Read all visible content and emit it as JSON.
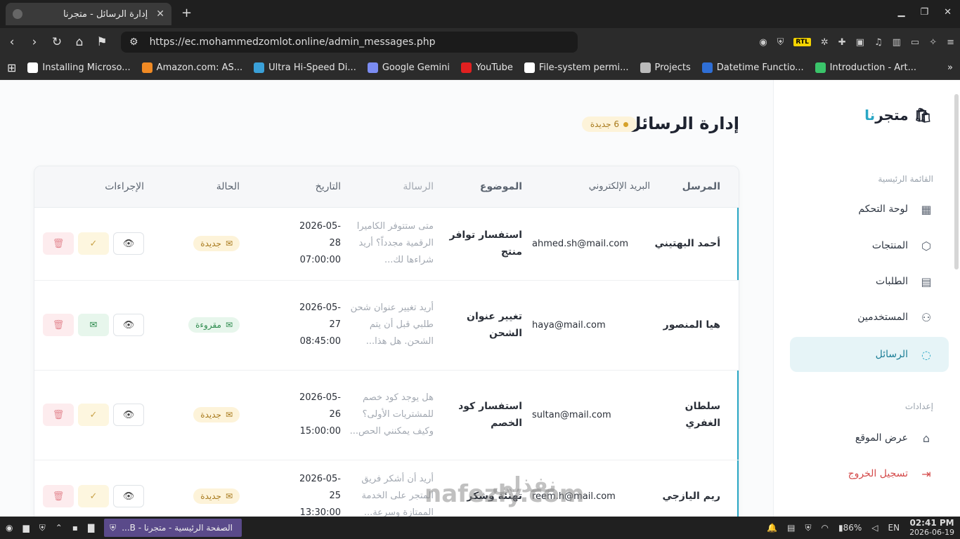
{
  "browser": {
    "tab_title": "إدارة الرسائل - متجرنا",
    "url": "https://ec.mohammedzomlot.online/admin_messages.php",
    "bookmarks": [
      {
        "label": "Installing Microso...",
        "color": "#ffffff"
      },
      {
        "label": "Amazon.com: AS...",
        "color": "#f08a24"
      },
      {
        "label": "Ultra Hi-Speed Di...",
        "color": "#3aa0d8"
      },
      {
        "label": "Google Gemini",
        "color": "#7b8cf2"
      },
      {
        "label": "YouTube",
        "color": "#e02020"
      },
      {
        "label": "File-system permi...",
        "color": "#ffffff"
      },
      {
        "label": "Projects",
        "color": "#bbbbbb"
      },
      {
        "label": "Datetime Functio...",
        "color": "#2f6fd6"
      },
      {
        "label": "Introduction - Art...",
        "color": "#3ac46a"
      }
    ]
  },
  "sidebar": {
    "brand_main": "متجر",
    "brand_accent": "نا",
    "section_main": "القائمة الرئيسية",
    "items": [
      {
        "label": "لوحة التحكم",
        "icon": "▦"
      },
      {
        "label": "المنتجات",
        "icon": "⬡"
      },
      {
        "label": "الطلبات",
        "icon": "▤"
      },
      {
        "label": "المستخدمين",
        "icon": "⚇"
      },
      {
        "label": "الرسائل",
        "icon": "◌"
      }
    ],
    "section_settings": "إعدادات",
    "view_site": "عرض الموقع",
    "logout": "تسجيل الخروج"
  },
  "main": {
    "title": "إدارة الرسائل",
    "new_badge": "6 جديدة",
    "columns": [
      "المرسل",
      "البريد الإلكتروني",
      "الموضوع",
      "الرسالة",
      "التاريخ",
      "الحالة",
      "الإجراءات"
    ],
    "rows": [
      {
        "sender": "أحمد البهتيني",
        "email": "ahmed.sh@mail.com",
        "subject": "استفسار توافر منتج",
        "message": "متى ستتوفر الكاميرا الرقمية مجدداً؟ أريد شراءها لك...",
        "date1": "2026-05-",
        "date2": "28",
        "time": "07:00:00",
        "status": "جديدة",
        "status_type": "new"
      },
      {
        "sender": "هيا المنصور",
        "email": "haya@mail.com",
        "subject": "تغيير عنوان الشحن",
        "message": "أريد تغيير عنوان شحن طلبي قبل أن يتم الشحن. هل هذا...",
        "date1": "2026-05-",
        "date2": "27",
        "time": "08:45:00",
        "status": "مقروءة",
        "status_type": "read"
      },
      {
        "sender": "سلطان الغفري",
        "email": "sultan@mail.com",
        "subject": "استفسار كود الخصم",
        "message": "هل يوجد كود خصم للمشتريات الأولى؟ وكيف يمكنني الحص...",
        "date1": "2026-05-",
        "date2": "26",
        "time": "15:00:00",
        "status": "جديدة",
        "status_type": "new"
      },
      {
        "sender": "ريم اليازجي",
        "email": "reem.h@mail.com",
        "subject": "تهنئة وشكر",
        "message": "أريد أن أشكر فريق المتجر على الخدمة الممتازة وسرعة...",
        "date1": "2026-05-",
        "date2": "25",
        "time": "13:30:00",
        "status": "جديدة",
        "status_type": "new"
      }
    ]
  },
  "taskbar": {
    "task_label": "الصفحة الرئيسية - متجرنا - B...",
    "battery": "86%",
    "lang": "EN",
    "time": "02:41 PM",
    "date": "2026-06-19"
  },
  "watermark": "nafezly.com",
  "watermark_ar": "نفذلي"
}
